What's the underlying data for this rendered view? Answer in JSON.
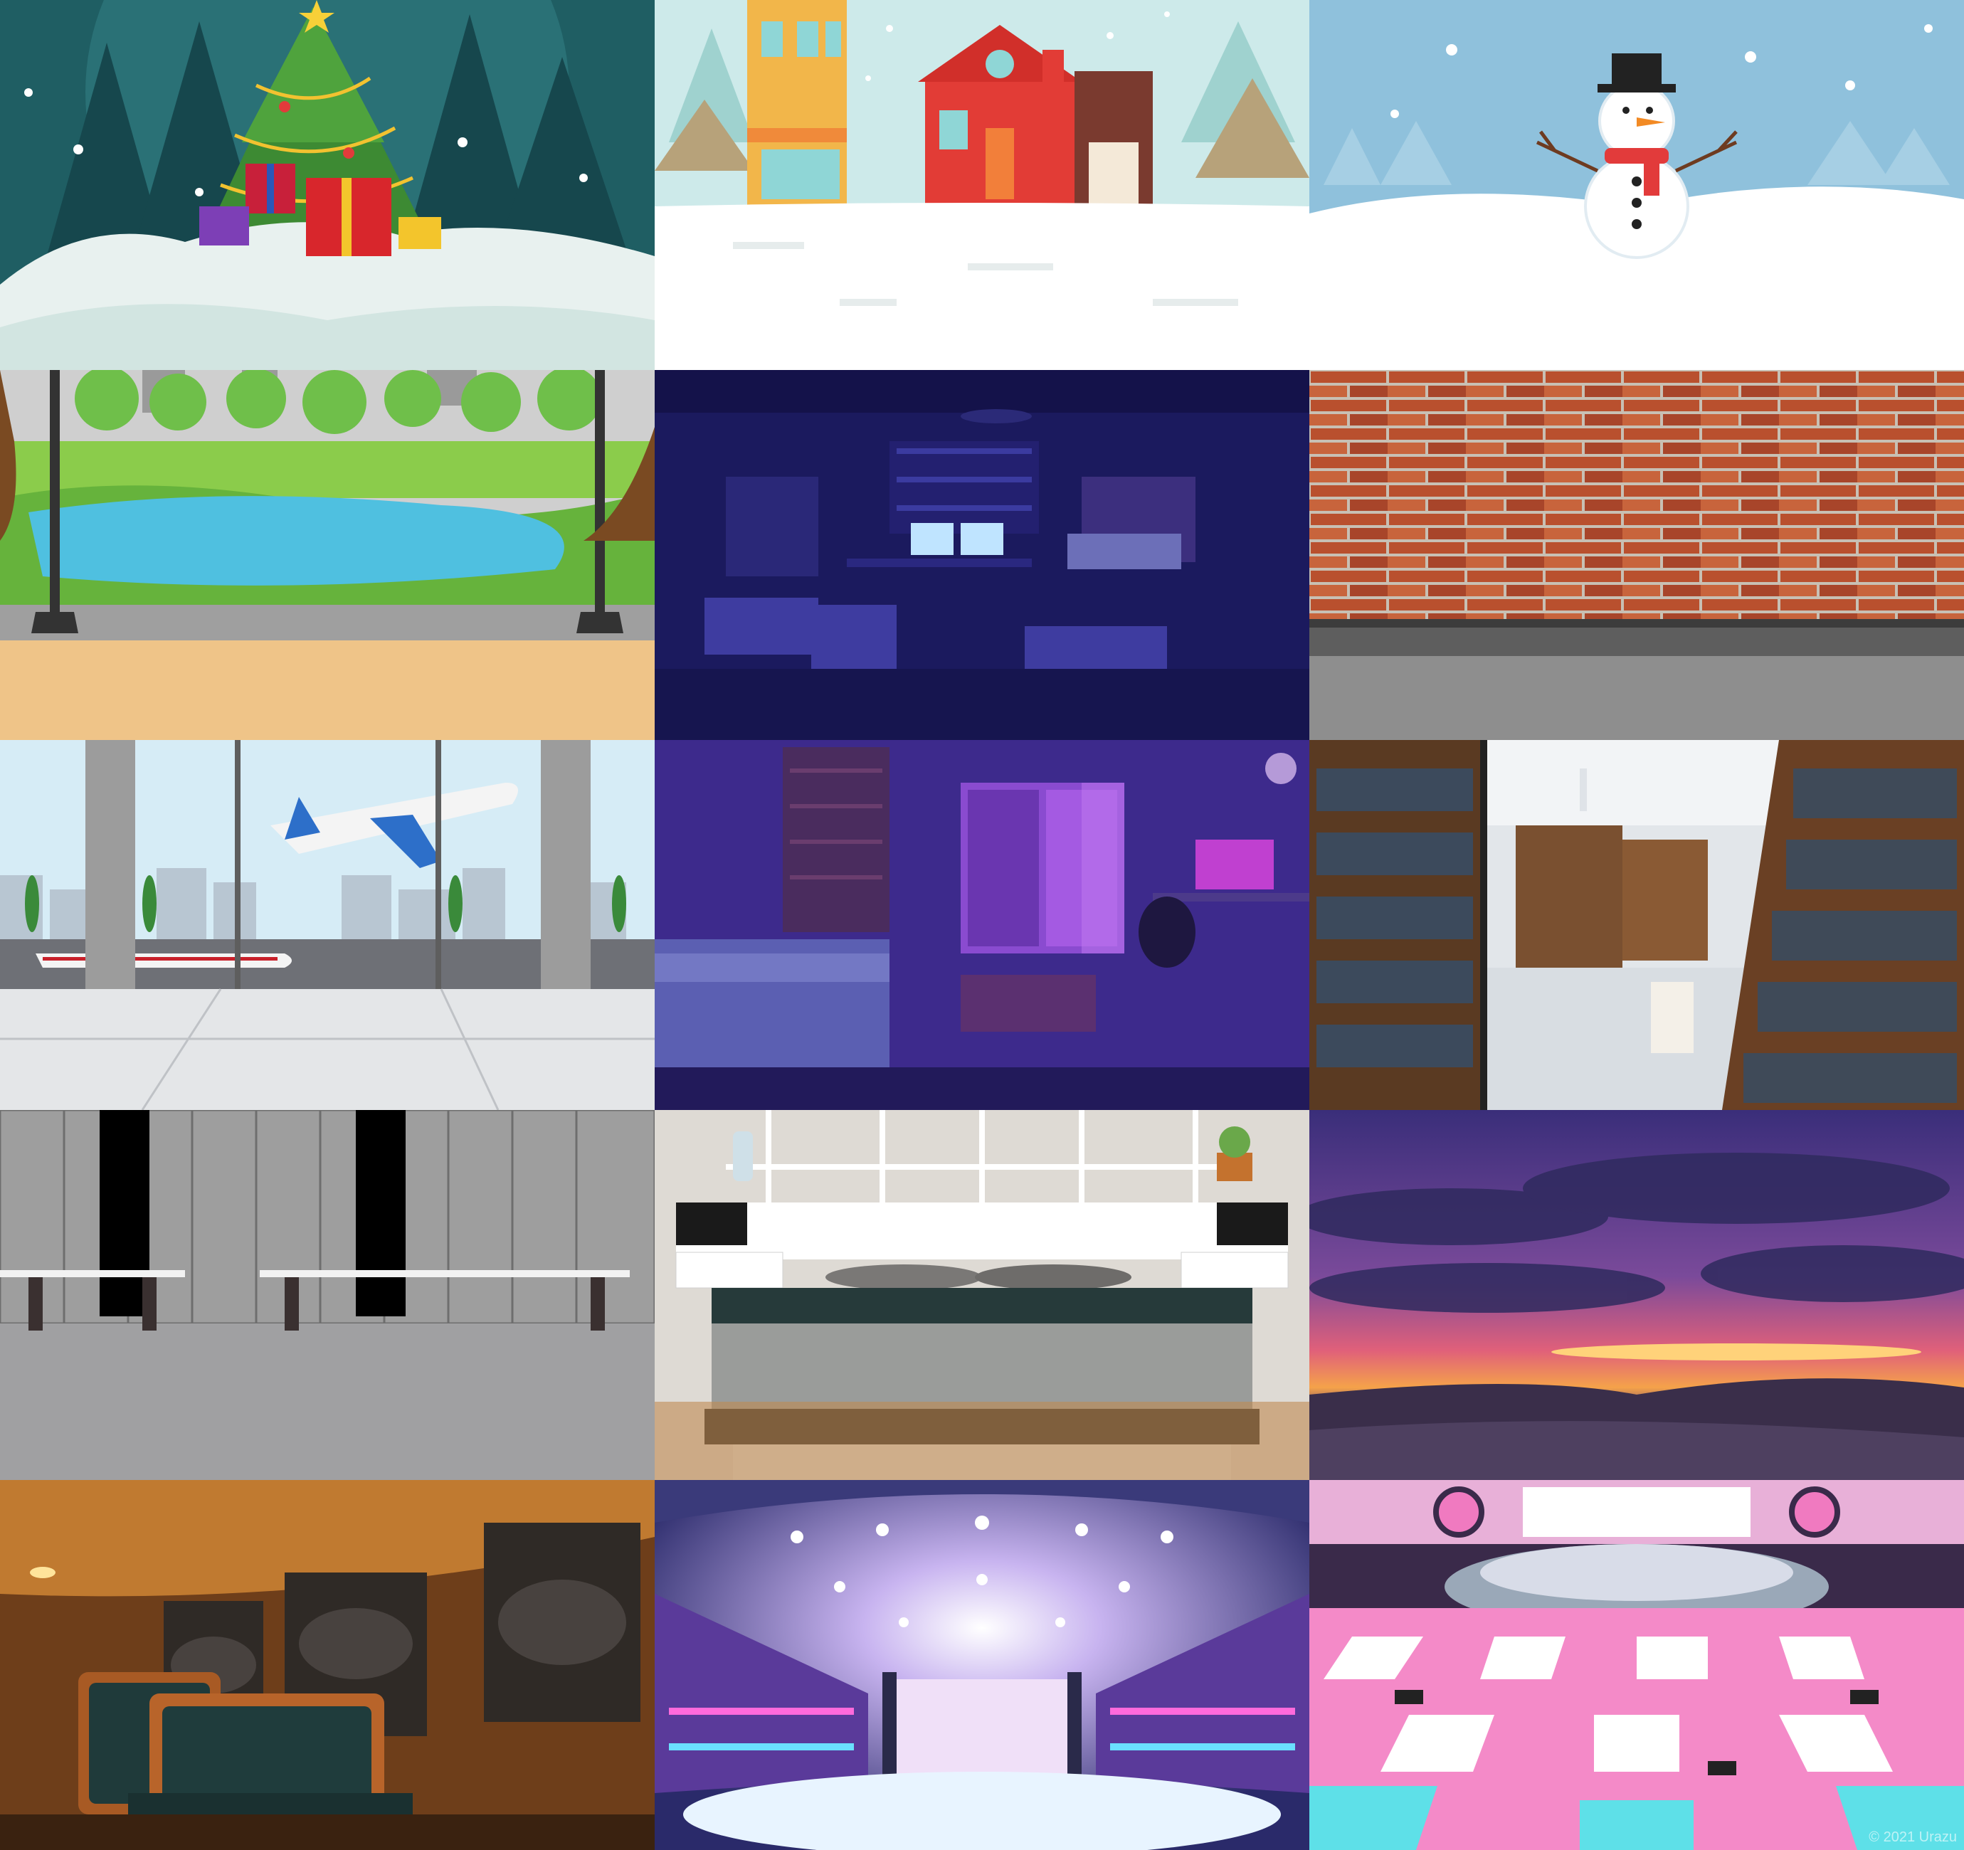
{
  "gallery": {
    "tiles": [
      {
        "id": "christmas-tree"
      },
      {
        "id": "snowy-houses"
      },
      {
        "id": "snowman"
      },
      {
        "id": "park-lake"
      },
      {
        "id": "night-studio-room"
      },
      {
        "id": "brick-wall"
      },
      {
        "id": "airport-terminal"
      },
      {
        "id": "purple-bedroom"
      },
      {
        "id": "library-aisle"
      },
      {
        "id": "locker-room"
      },
      {
        "id": "modern-bedroom"
      },
      {
        "id": "sunset-sky"
      },
      {
        "id": "train-cabin"
      },
      {
        "id": "concert-stage"
      },
      {
        "id": "idol-stage"
      }
    ],
    "watermark": "© 2021 Urazu"
  }
}
